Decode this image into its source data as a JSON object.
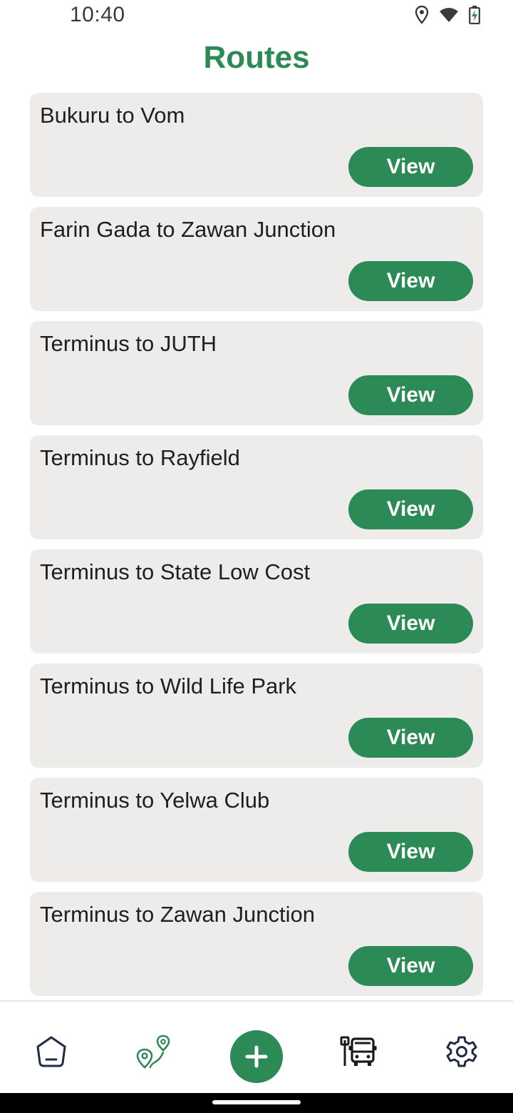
{
  "status": {
    "time": "10:40"
  },
  "header": {
    "title": "Routes"
  },
  "routes": [
    {
      "name": "Bukuru to Vom",
      "button": "View"
    },
    {
      "name": "Farin Gada to Zawan Junction",
      "button": "View"
    },
    {
      "name": "Terminus to JUTH",
      "button": "View"
    },
    {
      "name": "Terminus to Rayfield",
      "button": "View"
    },
    {
      "name": "Terminus to State Low Cost",
      "button": "View"
    },
    {
      "name": "Terminus to Wild Life Park",
      "button": "View"
    },
    {
      "name": "Terminus to Yelwa Club",
      "button": "View"
    },
    {
      "name": "Terminus to Zawan Junction",
      "button": "View"
    }
  ],
  "nav": {
    "items": [
      {
        "icon": "home-icon"
      },
      {
        "icon": "route-pins-icon"
      },
      {
        "icon": "plus-icon"
      },
      {
        "icon": "bus-stop-icon"
      },
      {
        "icon": "gear-icon"
      }
    ]
  },
  "colors": {
    "accent": "#2b8a55",
    "card": "#eeeceb",
    "nav_icon": "#1f2a44"
  }
}
